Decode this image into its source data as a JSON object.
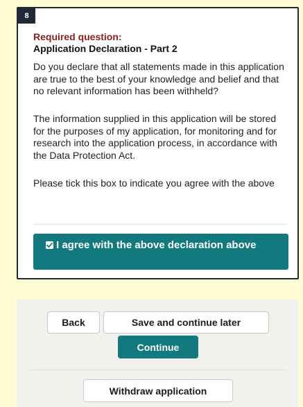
{
  "question": {
    "number": "8",
    "required_label": "Required question:",
    "title": "Application Declaration - Part 2",
    "paragraphs": [
      "Do you declare that all statements made in this application are true to the best of your knowledge and belief and that no relevant information has been withheld?",
      "The information supplied in this application will be stored for the purposes of my application, for monitoring and for research into the application process, in accordance with the Data Protection Act.",
      "Please tick this box to indicate you agree with the above"
    ],
    "agree_checkbox": {
      "checked": true,
      "label": "I agree with the above declaration above"
    }
  },
  "actions": {
    "back_label": "Back",
    "save_label": "Save and continue later",
    "continue_label": "Continue",
    "withdraw_label": "Withdraw application"
  },
  "colors": {
    "page_background": "#fdfbd1",
    "accent_teal": "#127a7f",
    "required_red": "#8c1d1d",
    "card_border": "#1f2a36"
  },
  "icons": {
    "checkbox": "checkmark-icon"
  }
}
